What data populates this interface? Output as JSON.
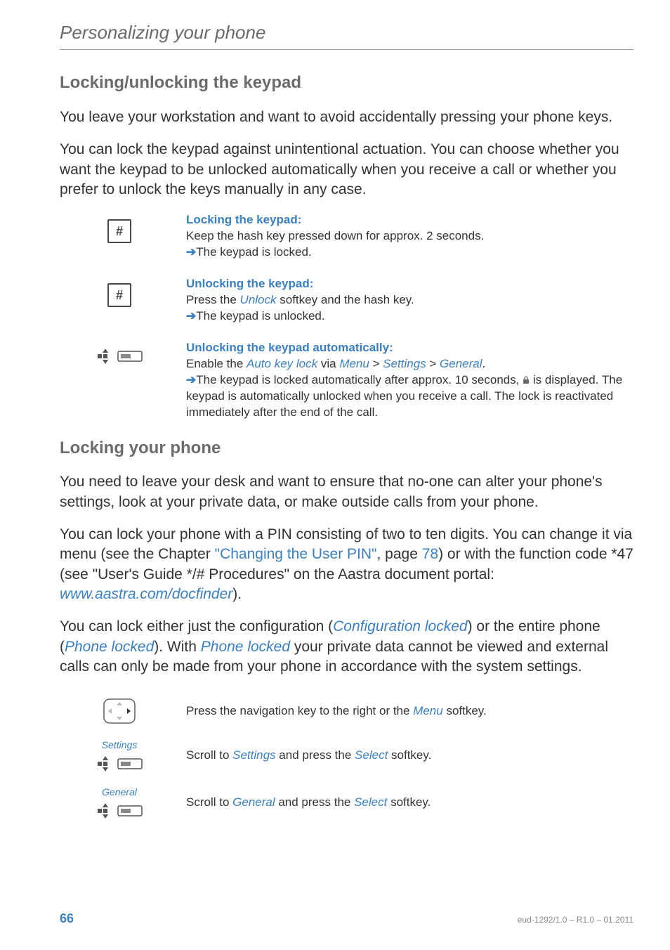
{
  "runningHead": "Personalizing your phone",
  "section1": {
    "title": "Locking/unlocking the keypad",
    "p1": "You leave your workstation and want to avoid accidentally pressing your phone keys.",
    "p2": "You can lock the keypad against unintentional actuation. You can choose whether you want the keypad to be unlocked automatically when you receive a call or whether you prefer to unlock the keys manually in any case."
  },
  "blocks": {
    "lock": {
      "heading": "Locking the keypad:",
      "line1": "Keep the hash key pressed down for approx. 2 seconds.",
      "result": "The keypad is locked."
    },
    "unlock": {
      "heading": "Unlocking the keypad:",
      "line1_pre": "Press the ",
      "line1_link": "Unlock",
      "line1_post": " softkey and the hash key.",
      "result": "The keypad is unlocked."
    },
    "auto": {
      "heading": "Unlocking the keypad automatically:",
      "enable_pre": "Enable the ",
      "enable_l1": "Auto key lock",
      "enable_mid1": " via ",
      "enable_l2": "Menu",
      "enable_mid2": " > ",
      "enable_l3": "Settings",
      "enable_mid3": " > ",
      "enable_l4": "General",
      "enable_post": ".",
      "result_pre": "The keypad is locked automatically after approx. 10 seconds, ",
      "result_post": " is displayed. The keypad is automatically unlocked when you receive a call. The lock is reactivated immediately after the end of the call."
    }
  },
  "section2": {
    "title": "Locking your phone",
    "p1": "You need to leave your desk and want to ensure that no-one can alter your phone's settings, look at your private data, or make outside calls from your phone.",
    "p2_pre": "You can lock your phone with a PIN consisting of two to ten digits. You can change it via menu (see the Chapter ",
    "p2_link1": "\"Changing the User PIN\"",
    "p2_mid1": ", page ",
    "p2_link2": "78",
    "p2_mid2": ") or with the function code *47 (see \"User's Guide */# Procedures\" on the Aastra document portal: ",
    "p2_link3": "www.aastra.com/docfinder",
    "p2_post": ").",
    "p3_pre": "You can lock either just the configuration (",
    "p3_l1": "Configuration locked",
    "p3_mid1": ") or the entire phone (",
    "p3_l2": "Phone locked",
    "p3_mid2": "). With ",
    "p3_l3": "Phone locked",
    "p3_post": " your private data cannot be viewed and external calls can only be made from your phone in accordance with the system settings."
  },
  "navsteps": {
    "step1_pre": "Press the navigation key to the right or the ",
    "step1_link": "Menu",
    "step1_post": " softkey.",
    "step2_pre": "Scroll to ",
    "step2_link1": "Settings",
    "step2_mid": " and press the ",
    "step2_link2": "Select",
    "step2_post": " softkey.",
    "step2_label": "Settings",
    "step3_pre": "Scroll to ",
    "step3_link1": "General",
    "step3_mid": " and press the ",
    "step3_link2": "Select",
    "step3_post": " softkey.",
    "step3_label": "General"
  },
  "footer": {
    "pageNum": "66",
    "docId": "eud-1292/1.0 – R1.0 – 01.2011"
  },
  "glyphs": {
    "hash": "#"
  }
}
